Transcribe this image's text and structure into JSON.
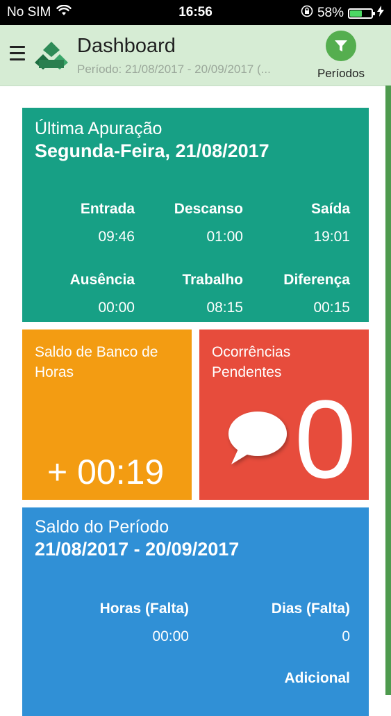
{
  "status": {
    "carrier": "No SIM",
    "time": "16:56",
    "battery_percent": "58%",
    "battery_level": 0.58
  },
  "header": {
    "title": "Dashboard",
    "subtitle": "Período: 21/08/2017 - 20/09/2017 (...",
    "filter_label": "Períodos"
  },
  "last_check": {
    "title": "Última Apuração",
    "date": "Segunda-Feira, 21/08/2017",
    "fields": [
      {
        "label": "Entrada",
        "value": "09:46"
      },
      {
        "label": "Descanso",
        "value": "01:00"
      },
      {
        "label": "Saída",
        "value": "19:01"
      },
      {
        "label": "Ausência",
        "value": "00:00"
      },
      {
        "label": "Trabalho",
        "value": "08:15"
      },
      {
        "label": "Diferença",
        "value": "00:15"
      }
    ]
  },
  "bank": {
    "title": "Saldo de Banco de Horas",
    "value": "+ 00:19"
  },
  "occurrences": {
    "title": "Ocorrências Pendentes",
    "count": "0"
  },
  "period": {
    "title": "Saldo do Período",
    "range": "21/08/2017 - 20/09/2017",
    "fields": [
      {
        "label": "Horas (Falta)",
        "value": "00:00"
      },
      {
        "label": "Dias (Falta)",
        "value": "0"
      }
    ],
    "partial_label": "Adicional"
  },
  "colors": {
    "header_bg": "#d6ecd4",
    "teal": "#17a085",
    "orange": "#f39c12",
    "red": "#e74c3c",
    "blue": "#3090d6",
    "accent_green": "#55ae4f"
  }
}
